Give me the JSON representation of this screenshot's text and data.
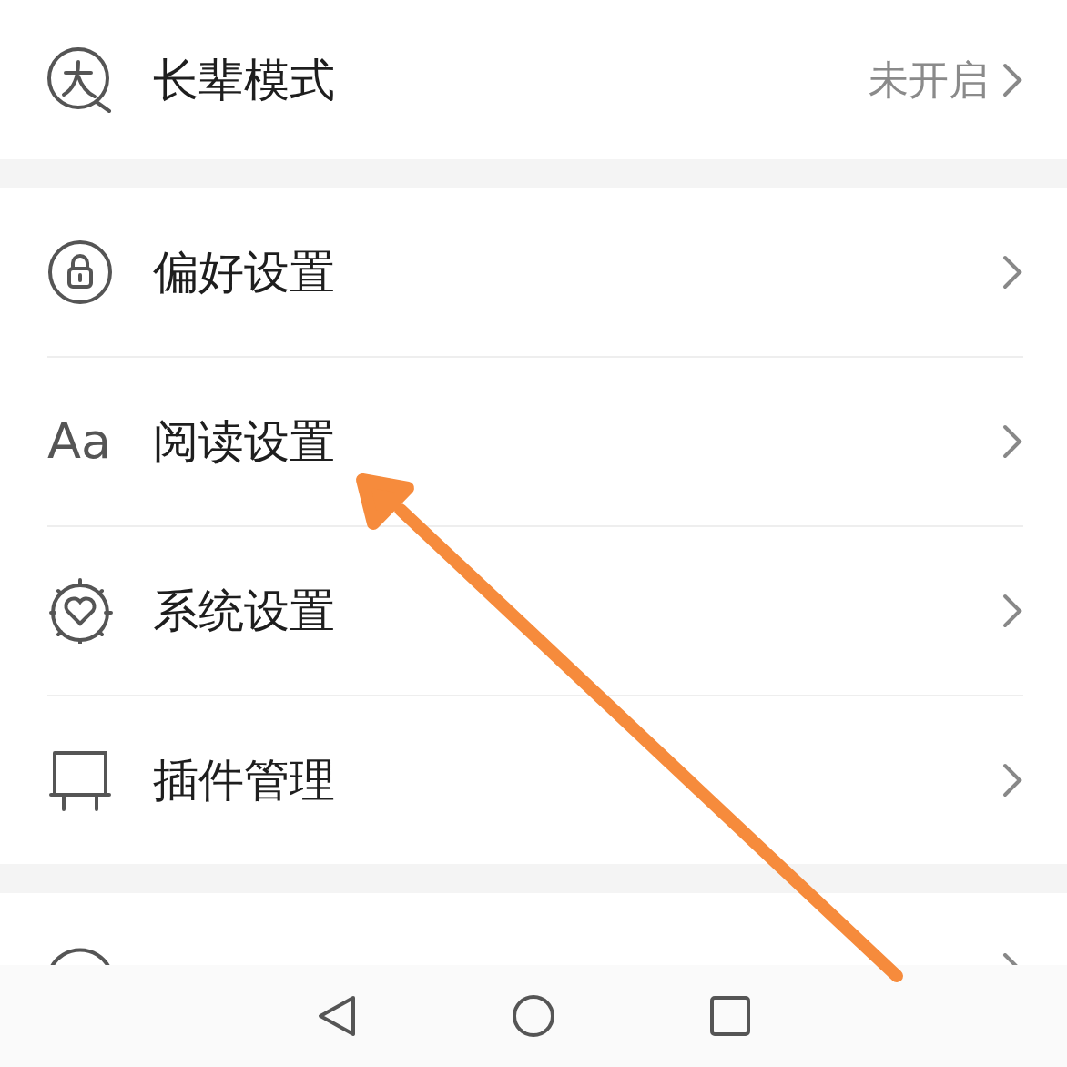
{
  "elder_mode": {
    "label": "长辈模式",
    "status": "未开启"
  },
  "settings": [
    {
      "kind": "lock",
      "label": "偏好设置"
    },
    {
      "kind": "text",
      "icon_text": "Aa",
      "label": "阅读设置"
    },
    {
      "kind": "heart",
      "label": "系统设置"
    },
    {
      "kind": "plugin",
      "label": "插件管理"
    }
  ]
}
